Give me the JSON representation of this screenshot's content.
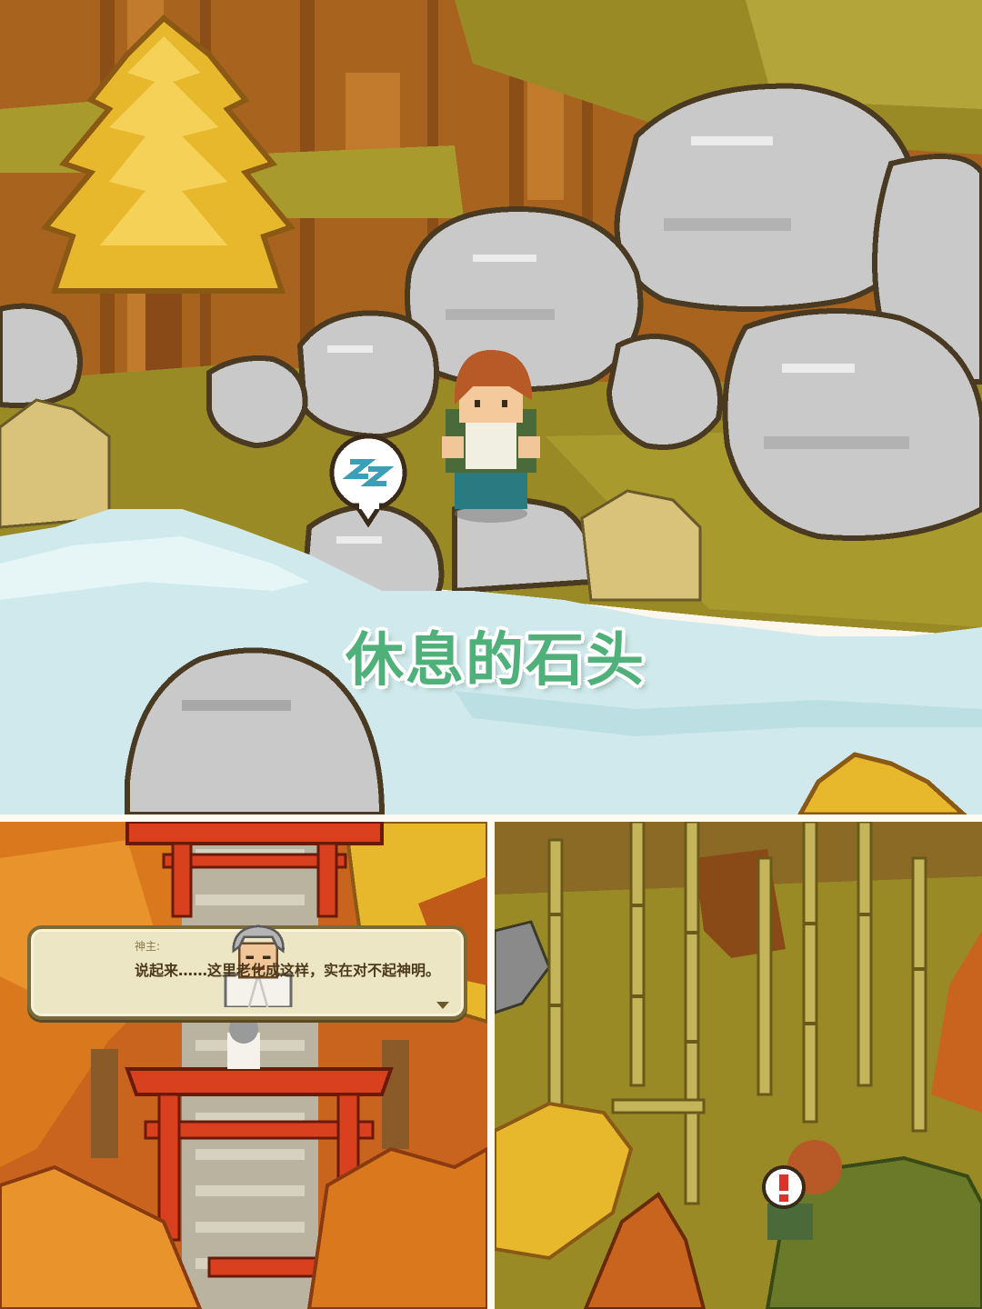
{
  "caption": {
    "text": "休息的石头",
    "color": "#4fb07a"
  },
  "scene_top": {
    "speech_bubble_icon": "zz-rest-icon",
    "character": "boy-with-backpack"
  },
  "dialog": {
    "speaker": "神主:",
    "text": "说起来……这里老化成这样，实在对不起神明。",
    "portrait": "elderly-priest-portrait",
    "continue_icon": "triangle-down-icon"
  },
  "scene_bottom_right": {
    "alert_icon": "exclamation-icon",
    "character": "boy-in-bushes"
  },
  "colors": {
    "grass": "#9a8a26",
    "cliff": "#b06a22",
    "rock": "#c9c9c9",
    "water": "#cfe9ec",
    "torii": "#d8401e",
    "maple": "#d9781c",
    "ginkgo": "#e6b62a",
    "bamboo": "#b7a64a"
  }
}
